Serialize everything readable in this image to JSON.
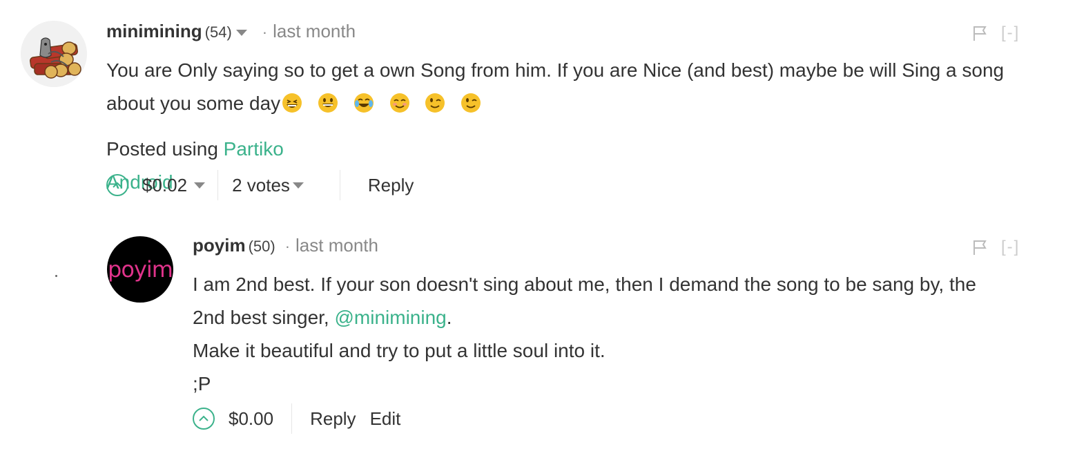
{
  "comments": [
    {
      "author": "minimining",
      "reputation": "(54)",
      "time": "last month",
      "collapse": "[-]",
      "body": {
        "text": "You are Only saying so to get a own Song from him. If you are Nice (and best) maybe be will Sing a song about you some day",
        "emoji": [
          "grinning-squinting-face",
          "grinning-face",
          "face-with-tears-of-joy",
          "smiling-face",
          "winking-face",
          "winking-face"
        ],
        "posted_prefix": "Posted using ",
        "posted_link": "Partiko Android"
      },
      "payout": "$0.02",
      "votes": "2 votes",
      "reply": "Reply"
    },
    {
      "author": "poyim",
      "avatar_text": "poyim",
      "reputation": "(50)",
      "time": "last month",
      "collapse": "[-]",
      "body": {
        "line1": "I am 2nd best. If your son doesn't sing about me, then I demand the song to be sang by, the",
        "line2_prefix": "2nd best singer, ",
        "mention": "@minimining",
        "line2_suffix": ".",
        "line3": "Make it beautiful and try to put a little soul into it.",
        "line4": ";P"
      },
      "payout": "$0.00",
      "reply": "Reply",
      "edit": "Edit"
    }
  ],
  "colors": {
    "link": "#3bb28b",
    "text": "#333333",
    "muted": "#888888",
    "avatar_bg": "#000000",
    "avatar_text": "#e0338b"
  }
}
